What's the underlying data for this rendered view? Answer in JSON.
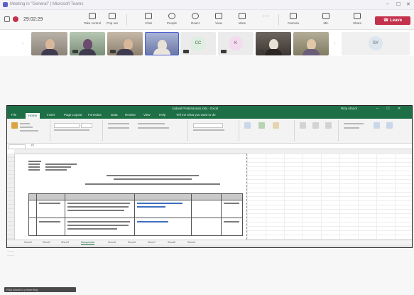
{
  "window": {
    "title": "Meeting in \"General\" | Microsoft Teams"
  },
  "toolbar": {
    "timer": "29:02:29",
    "buttons": [
      {
        "label": "Take control"
      },
      {
        "label": "Pop out"
      },
      {
        "label": "Chat"
      },
      {
        "label": "People"
      },
      {
        "label": "React"
      },
      {
        "label": "View"
      },
      {
        "label": "More"
      },
      {
        "label": "Camera"
      },
      {
        "label": "Mic"
      },
      {
        "label": "Share"
      }
    ],
    "leave_label": "Leave"
  },
  "participants": [
    {
      "type": "video",
      "style": "man"
    },
    {
      "type": "video",
      "style": "woman-dark"
    },
    {
      "type": "video",
      "style": "two"
    },
    {
      "type": "video",
      "style": "woman-light"
    },
    {
      "type": "initials",
      "initials": "CC",
      "color": "#dcefe0"
    },
    {
      "type": "initials",
      "initials": "K",
      "color": "#f3dcef"
    },
    {
      "type": "video",
      "style": "room"
    },
    {
      "type": "video",
      "style": "woman-outdoor"
    },
    {
      "type": "initials",
      "initials": "SY",
      "color": "#dde6ee"
    }
  ],
  "excel": {
    "title": "Jadwal Pelaksanaan.xlsx - Excel",
    "user": "Rifqi Afandi",
    "tabs": [
      "File",
      "Home",
      "Insert",
      "Page Layout",
      "Formulas",
      "Data",
      "Review",
      "View",
      "Help",
      "Tell me what you want to do"
    ],
    "active_tab": "Home",
    "sheets": [
      "Sheet1",
      "Sheet2",
      "Sheet3",
      "Rekapitulasi",
      "Sheet5",
      "Sheet6",
      "Sheet7",
      "Sheet8",
      "Sheet9"
    ],
    "active_sheet": "Rekapitulasi"
  },
  "presenter_caption": "Rifqi Afandi is presenting"
}
